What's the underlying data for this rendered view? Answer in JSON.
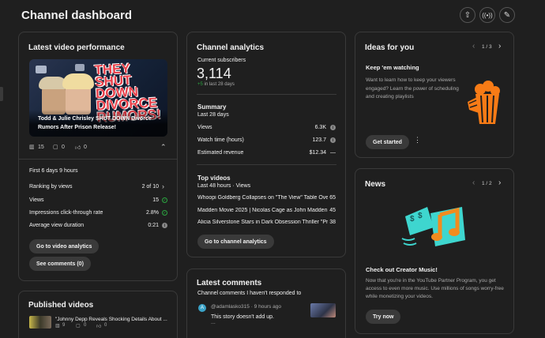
{
  "header": {
    "title": "Channel dashboard"
  },
  "performance": {
    "title": "Latest video performance",
    "thumb_text": "THEY SHUT DOWN DIVORCE RUMORS!",
    "video_title": "Todd & Julie Chrisley SHUT DOWN Divorce Rumors After Prison Release!",
    "views": "15",
    "comments": "0",
    "likes": "0",
    "first_period": "First 6 days 9 hours",
    "ranking_label": "Ranking by views",
    "ranking_value": "2 of 10",
    "views_label": "Views",
    "views_value": "15",
    "ctr_label": "Impressions click-through rate",
    "ctr_value": "2.8%",
    "avd_label": "Average view duration",
    "avd_value": "0:21",
    "analytics_button": "Go to video analytics",
    "comments_button": "See comments (0)"
  },
  "published": {
    "title": "Published videos",
    "item_title": "\"Johnny Depp Reveals Shocking Details About ...",
    "views": "9",
    "comments": "0",
    "likes": "0"
  },
  "analytics": {
    "title": "Channel analytics",
    "subs_label": "Current subscribers",
    "subs_value": "3,114",
    "subs_delta": "+5",
    "subs_delta_period": "in last 28 days",
    "summary_title": "Summary",
    "summary_period": "Last 28 days",
    "views_label": "Views",
    "views_value": "6.3K",
    "watch_label": "Watch time (hours)",
    "watch_value": "123.7",
    "revenue_label": "Estimated revenue",
    "revenue_value": "$12.34",
    "revenue_trend": "—",
    "top_title": "Top videos",
    "top_period": "Last 48 hours · Views",
    "top_videos": [
      {
        "title": "Whoopi Goldberg Collapses on \"The View\" Table Over ...",
        "views": "65"
      },
      {
        "title": "Madden Movie 2025 | Nicolas Cage as John Madden ...",
        "views": "45"
      },
      {
        "title": "Alicia Silverstone Stars in Dark Obsession Thriller \"Pre...",
        "views": "38"
      }
    ],
    "button": "Go to channel analytics"
  },
  "comments": {
    "title": "Latest comments",
    "subtitle": "Channel comments I haven't responded to",
    "avatar_letter": "A",
    "author": "@adamlasko315",
    "time": "9 hours ago",
    "text": "This story doesn't add up.",
    "more": "..."
  },
  "ideas": {
    "title": "Ideas for you",
    "pager": "1 / 3",
    "card_title": "Keep 'em watching",
    "card_text": "Want to learn how to keep your viewers engaged? Learn the power of scheduling and creating playlists",
    "button": "Get started"
  },
  "news": {
    "title": "News",
    "pager": "1 / 2",
    "card_title": "Check out Creator Music!",
    "card_text": "Now that you're in the YouTube Partner Program, you get access to even more music. Use millions of songs worry-free while monetizing your videos.",
    "button": "Try now"
  },
  "colors": {
    "background": "#1f1f1f",
    "card_border": "#3a3a3a",
    "positive": "#2ba640",
    "popcorn": "#f77b16",
    "music_teal": "#3ed6cf",
    "music_note": "#f28b1e"
  }
}
